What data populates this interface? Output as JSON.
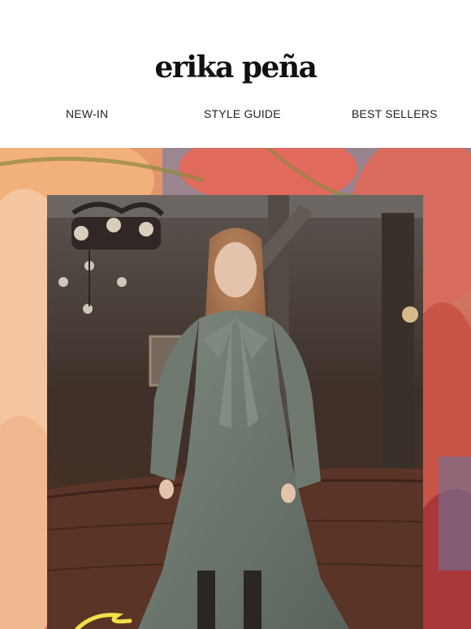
{
  "brand": {
    "name": "erika peña"
  },
  "nav": {
    "items": [
      {
        "label": "NEW-IN"
      },
      {
        "label": "STYLE GUIDE"
      },
      {
        "label": "BEST SELLERS"
      }
    ]
  },
  "hero": {
    "image_description_icon": "model-in-green-dress-photo",
    "colors": {
      "dress": "#6f7a70",
      "backdrop_floral": "#e58a6a",
      "room": "#3b2e27"
    }
  }
}
